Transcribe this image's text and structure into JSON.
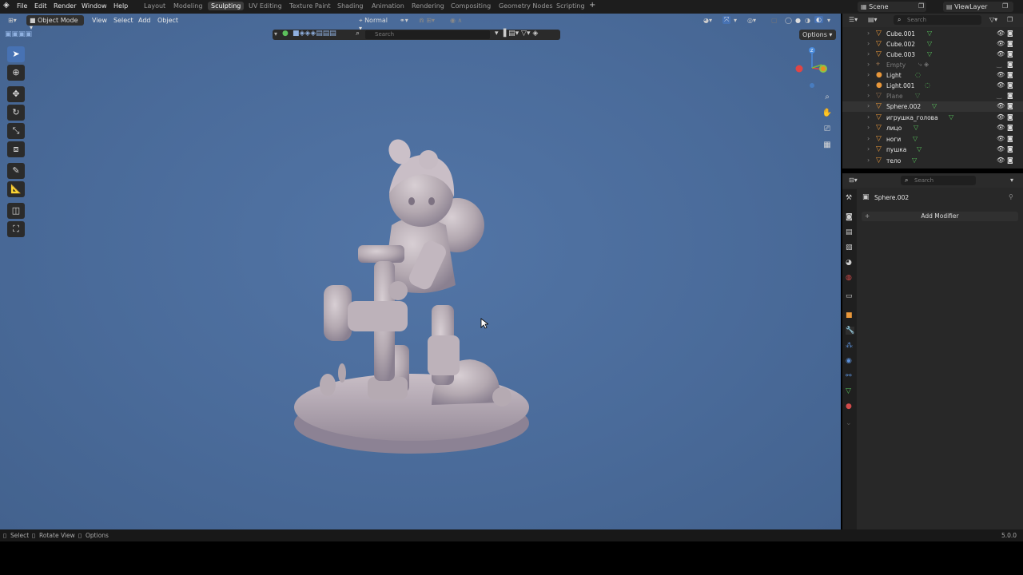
{
  "menu": [
    "File",
    "Edit",
    "Render",
    "Window",
    "Help"
  ],
  "workspaces": [
    "Layout",
    "Modeling",
    "Sculpting",
    "UV Editing",
    "Texture Paint",
    "Shading",
    "Animation",
    "Rendering",
    "Compositing",
    "Geometry Nodes",
    "Scripting"
  ],
  "active_workspace": "Sculpting",
  "scene": "Scene",
  "view_layer": "ViewLayer",
  "viewport": {
    "mode": "Object Mode",
    "menus": [
      "View",
      "Select",
      "Add",
      "Object"
    ],
    "orientation": "Normal",
    "options": "Options",
    "search_placeholder": "Search"
  },
  "outliner": {
    "search_placeholder": "Search",
    "items": [
      {
        "name": "Cube.001",
        "type": "mesh",
        "dim": false
      },
      {
        "name": "Cube.002",
        "type": "mesh",
        "dim": false
      },
      {
        "name": "Cube.003",
        "type": "mesh",
        "dim": false
      },
      {
        "name": "Empty",
        "type": "empty",
        "dim": true
      },
      {
        "name": "Light",
        "type": "light",
        "dim": false
      },
      {
        "name": "Light.001",
        "type": "light",
        "dim": false
      },
      {
        "name": "Plane",
        "type": "mesh",
        "dim": true
      },
      {
        "name": "Sphere.002",
        "type": "mesh",
        "dim": false
      },
      {
        "name": "игрушка_голова",
        "type": "mesh",
        "dim": false
      },
      {
        "name": "лицо",
        "type": "mesh",
        "dim": false
      },
      {
        "name": "ноги",
        "type": "mesh",
        "dim": false
      },
      {
        "name": "пушка",
        "type": "mesh",
        "dim": false
      },
      {
        "name": "тело",
        "type": "mesh",
        "dim": false
      }
    ]
  },
  "properties": {
    "search_placeholder": "Search",
    "object": "Sphere.002",
    "add_modifier": "Add Modifier"
  },
  "statusbar": {
    "select": "Select",
    "rotate": "Rotate View",
    "options": "Options",
    "version": "5.0.0"
  },
  "colors": {
    "accent": "#4772b3",
    "viewport_bg": "#4a6b9a",
    "mesh_icon": "#e8973a",
    "modifier_icon": "#58c05c",
    "sculpt_clay": "#b9aeb4"
  }
}
